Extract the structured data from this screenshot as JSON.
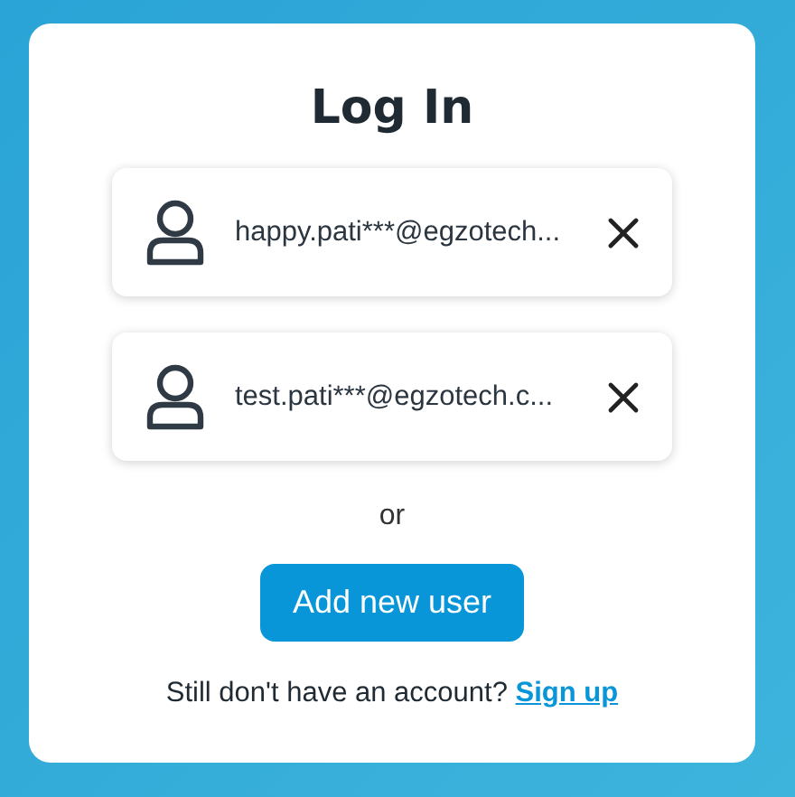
{
  "title": "Log In",
  "users": [
    {
      "email": "happy.pati***@egzotech..."
    },
    {
      "email": "test.pati***@egzotech.c..."
    }
  ],
  "separator": "or",
  "add_button": "Add new user",
  "footer": {
    "text": "Still don't have an account?",
    "link": "Sign up"
  }
}
